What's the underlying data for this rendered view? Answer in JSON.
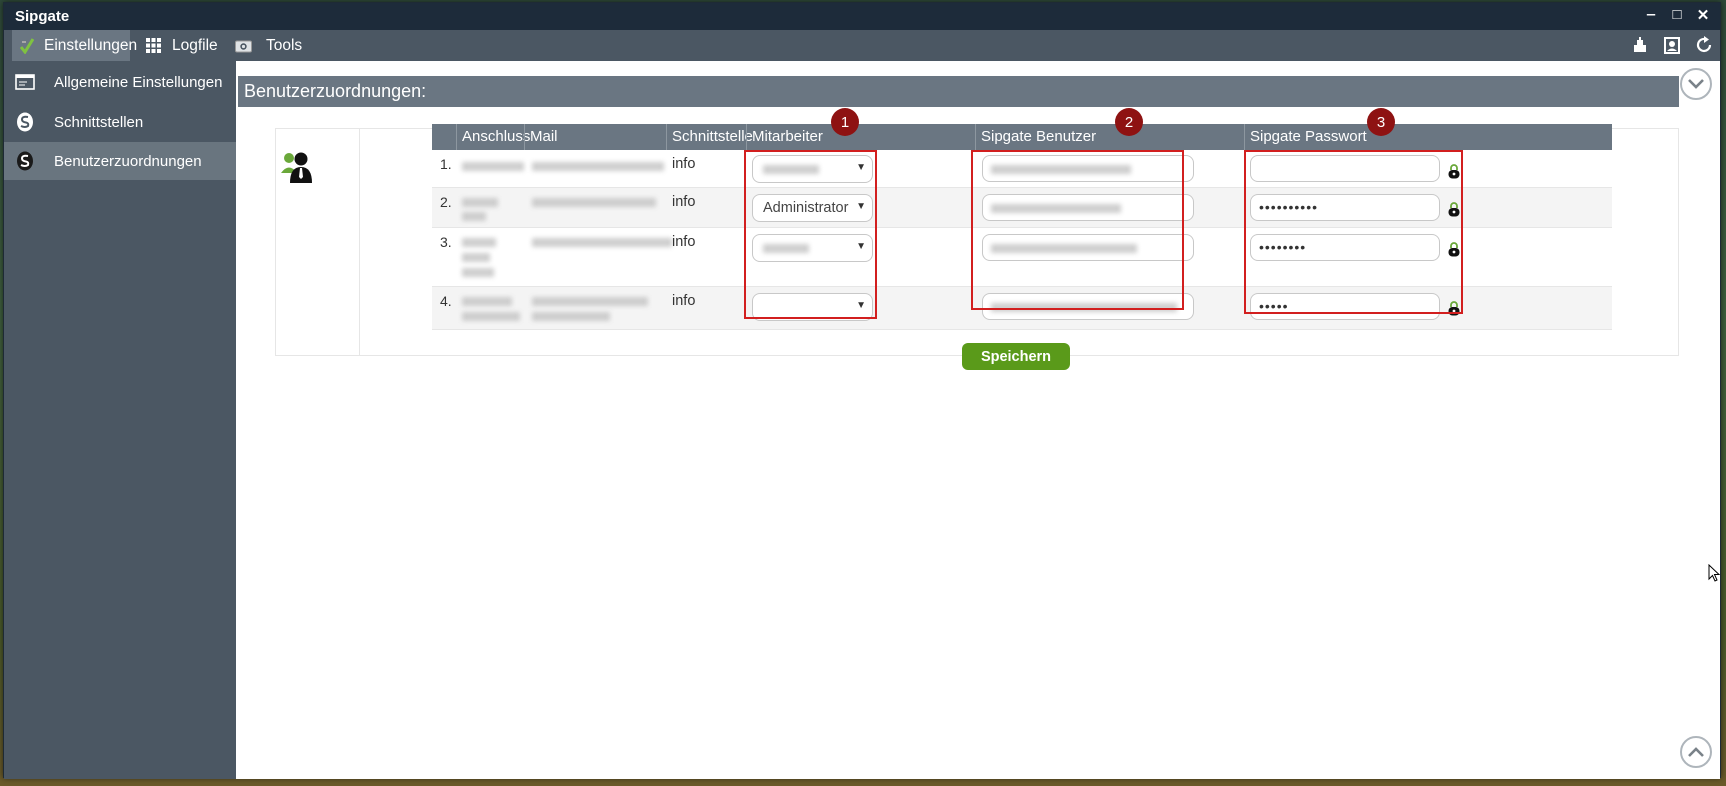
{
  "window": {
    "title": "Sipgate"
  },
  "window_controls": {
    "minimize": "‒",
    "maximize": "□",
    "close": "✕"
  },
  "menu": {
    "items": [
      {
        "label": "Einstellungen",
        "icon": "checkmark-icon",
        "active": true
      },
      {
        "label": "Logfile",
        "icon": "grid-icon",
        "active": false
      },
      {
        "label": "Tools",
        "icon": "camera-icon",
        "active": false
      }
    ],
    "right_icons": [
      "plugin-icon",
      "contact-icon",
      "refresh-icon"
    ]
  },
  "sidebar": {
    "items": [
      {
        "label": "Allgemeine Einstellungen",
        "icon": "window-icon"
      },
      {
        "label": "Schnittstellen",
        "icon": "sipgate-s-icon"
      },
      {
        "label": "Benutzerzuordnungen",
        "icon": "sipgate-s-icon",
        "active": true
      }
    ]
  },
  "page": {
    "title": "Benutzerzuordnungen:"
  },
  "table": {
    "headers": {
      "anschluss": "Anschluss",
      "mail": "Mail",
      "schnittstelle": "Schnittstelle",
      "mitarbeiter": "Mitarbeiter",
      "sipgate_benutzer": "Sipgate Benutzer",
      "sipgate_passwort": "Sipgate Passwort"
    },
    "rows": [
      {
        "num": "1.",
        "schnittstelle": "info",
        "mitarbeiter": "",
        "password": ""
      },
      {
        "num": "2.",
        "schnittstelle": "info",
        "mitarbeiter": "Administrator",
        "password": "••••••••••"
      },
      {
        "num": "3.",
        "schnittstelle": "info",
        "mitarbeiter": "",
        "password": "••••••••"
      },
      {
        "num": "4.",
        "schnittstelle": "info",
        "mitarbeiter": "",
        "password": "•••••"
      }
    ]
  },
  "annotations": {
    "badge1": "1",
    "badge2": "2",
    "badge3": "3"
  },
  "actions": {
    "save_label": "Speichern"
  },
  "colors": {
    "accent_green": "#5a9a1a",
    "annotation_red": "#d21f1f",
    "badge_red": "#8e1212"
  }
}
